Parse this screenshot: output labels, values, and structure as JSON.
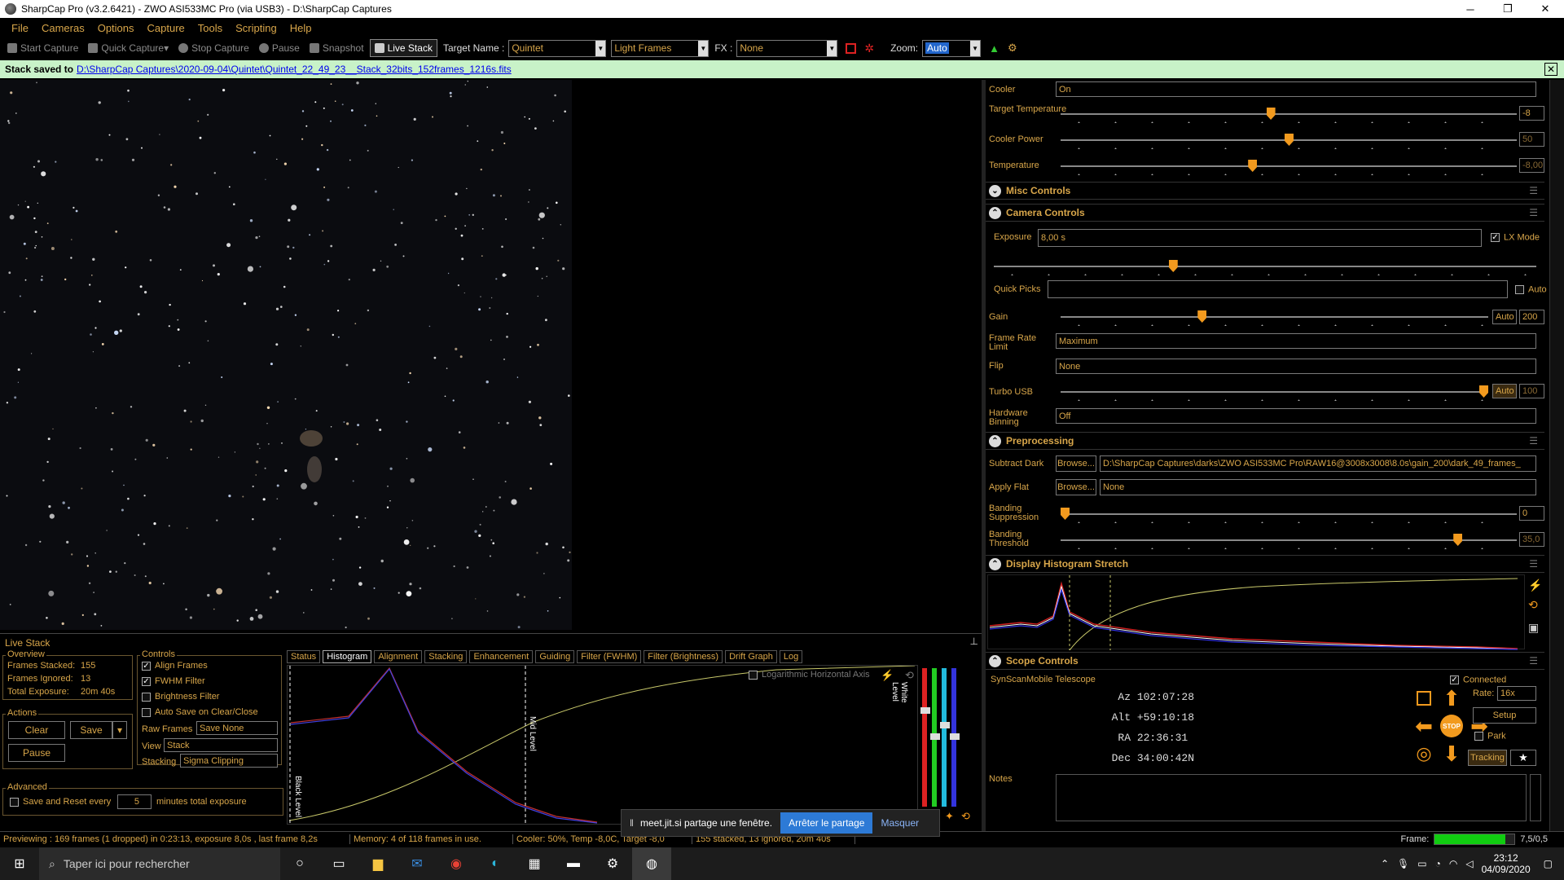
{
  "window": {
    "title": "SharpCap Pro (v3.2.6421) - ZWO ASI533MC Pro (via USB3) - D:\\SharpCap Captures",
    "minimize": "─",
    "maximize": "❐",
    "close": "✕"
  },
  "menu": [
    "File",
    "Cameras",
    "Options",
    "Capture",
    "Tools",
    "Scripting",
    "Help"
  ],
  "toolbar": {
    "start_capture": "Start Capture",
    "quick_capture": "Quick Capture",
    "stop_capture": "Stop Capture",
    "pause": "Pause",
    "snapshot": "Snapshot",
    "live_stack": "Live Stack",
    "target_name_label": "Target Name :",
    "target_name_value": "Quintet",
    "frame_type": "Light Frames",
    "fx_label": "FX :",
    "fx_value": "None",
    "zoom_label": "Zoom:",
    "zoom_value": "Auto"
  },
  "notification": {
    "prefix": "Stack saved to",
    "path": "D:\\SharpCap Captures\\2020-09-04\\Quintet\\Quintet_22_49_23__Stack_32bits_152frames_1216s.fits",
    "close": "✕"
  },
  "livestack": {
    "title": "Live Stack",
    "overview_title": "Overview",
    "frames_stacked_label": "Frames Stacked:",
    "frames_stacked": "155",
    "frames_ignored_label": "Frames Ignored:",
    "frames_ignored": "13",
    "total_exposure_label": "Total Exposure:",
    "total_exposure": "20m 40s",
    "actions_title": "Actions",
    "clear": "Clear",
    "save": "Save",
    "pause": "Pause",
    "advanced_title": "Advanced",
    "save_reset_label": "Save and Reset every",
    "save_reset_value": "5",
    "save_reset_suffix": "minutes total exposure",
    "controls_title": "Controls",
    "align_frames": "Align Frames",
    "fwhm_filter": "FWHM Filter",
    "brightness_filter": "Brightness Filter",
    "auto_save": "Auto Save on Clear/Close",
    "raw_frames_label": "Raw Frames",
    "raw_frames_value": "Save None",
    "view_label": "View",
    "view_value": "Stack",
    "stacking_label": "Stacking",
    "stacking_value": "Sigma Clipping",
    "tabs": [
      "Status",
      "Histogram",
      "Alignment",
      "Stacking",
      "Enhancement",
      "Guiding",
      "Filter (FWHM)",
      "Filter (Brightness)",
      "Drift Graph",
      "Log"
    ],
    "log_axis": "Logarithmic Horizontal Axis",
    "black_level": "Black Level",
    "mid_level": "Mid Level",
    "white_level": "White Level"
  },
  "camera": {
    "cooler_label": "Cooler",
    "cooler_value": "On",
    "target_temp_label": "Target Temperature",
    "target_temp_value": "-8",
    "target_temp_level": 0.46,
    "cooler_power_label": "Cooler Power",
    "cooler_power_value": "50",
    "cooler_power_level": 0.5,
    "temperature_label": "Temperature",
    "temperature_value": "-8,00",
    "temperature_level": 0.42,
    "misc_controls": "Misc Controls",
    "camera_controls": "Camera Controls",
    "exposure_label": "Exposure",
    "exposure_value": "8,00 s",
    "exposure_level": 0.33,
    "lx_mode": "LX Mode",
    "quick_picks_label": "Quick Picks",
    "quick_picks_auto": "Auto",
    "gain_label": "Gain",
    "gain_auto": "Auto",
    "gain_value": "200",
    "gain_level": 0.33,
    "frame_rate_label": "Frame Rate Limit",
    "frame_rate_value": "Maximum",
    "flip_label": "Flip",
    "flip_value": "None",
    "turbo_label": "Turbo USB",
    "turbo_auto": "Auto",
    "turbo_value": "100",
    "turbo_level": 1.0,
    "binning_label": "Hardware Binning",
    "binning_value": "Off",
    "preprocessing": "Preprocessing",
    "subtract_dark_label": "Subtract Dark",
    "browse": "Browse...",
    "dark_path": "D:\\SharpCap Captures\\darks\\ZWO ASI533MC Pro\\RAW16@3008x3008\\8.0s\\gain_200\\dark_49_frames_",
    "apply_flat_label": "Apply Flat",
    "flat_value": "None",
    "banding_supp_label": "Banding Suppression",
    "banding_supp_value": "0",
    "banding_supp_level": 0.0,
    "banding_thr_label": "Banding Threshold",
    "banding_thr_value": "35,0",
    "banding_thr_level": 0.87,
    "display_hist": "Display Histogram Stretch",
    "scope_controls": "Scope Controls",
    "telescope": "SynScanMobile Telescope",
    "connected": "Connected",
    "az_label": "Az",
    "az_value": "102:07:28",
    "alt_label": "Alt",
    "alt_value": "+59:10:18",
    "ra_label": "RA",
    "ra_value": "22:36:31",
    "dec_label": "Dec",
    "dec_value": "34:00:42N",
    "rate_label": "Rate:",
    "rate_value": "16x",
    "setup": "Setup",
    "park": "Park",
    "tracking": "Tracking",
    "stop": "STOP",
    "notes_label": "Notes"
  },
  "status": {
    "preview": "Previewing : 169 frames (1 dropped) in 0:23:13, exposure 8,0s , last frame 8,2s",
    "memory": "Memory: 4 of 118 frames in use.",
    "cooler": "Cooler: 50%, Temp -8,0C, Target -8,0",
    "stacked": "155 stacked, 13 ignored, 20m 40s",
    "frame_label": "Frame:",
    "frame_value": "7,5/0,5",
    "frame_level": 0.88
  },
  "jitsi": {
    "text": "meet.jit.si partage une fenêtre.",
    "stop": "Arrêter le partage",
    "hide": "Masquer"
  },
  "taskbar": {
    "search": "Taper ici pour rechercher",
    "time": "23:12",
    "date": "04/09/2020"
  },
  "colors": {
    "accent": "#d8a64a",
    "thumb": "#f29a1e",
    "notification": "#c8f2c8"
  }
}
